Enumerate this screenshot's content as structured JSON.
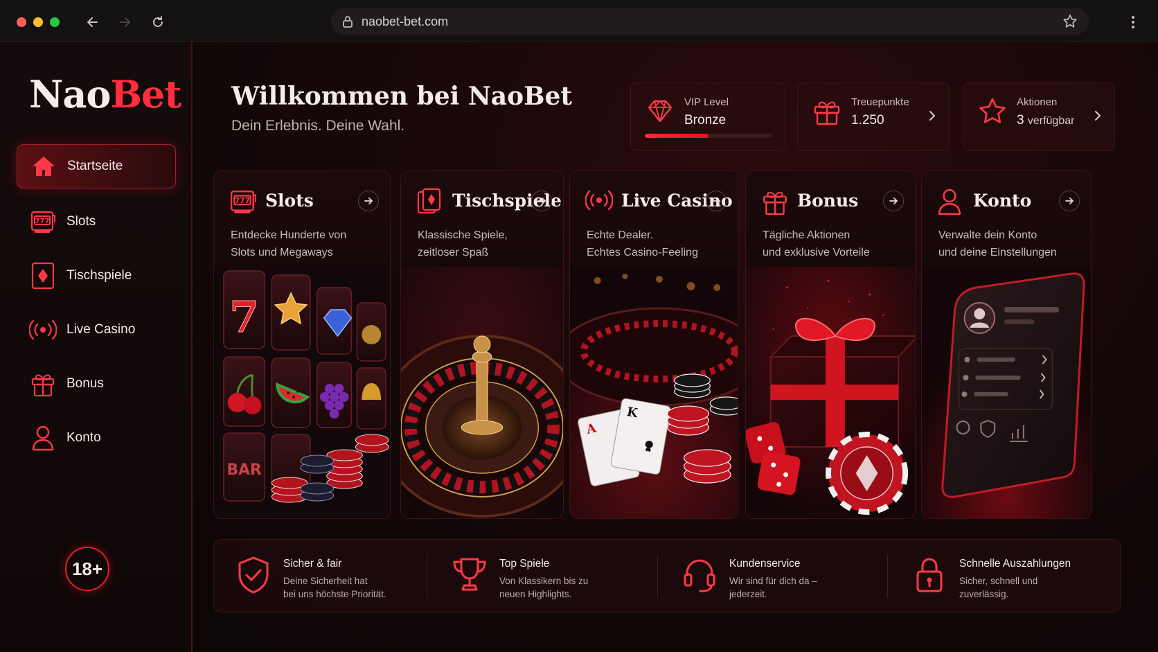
{
  "browser": {
    "url": "naobet-bet.com"
  },
  "brand": {
    "logo_part1": "Nao",
    "logo_part2": "Bet",
    "accent": "#ff2d3d"
  },
  "sidebar": {
    "items": [
      {
        "label": "Startseite",
        "icon": "home-icon",
        "active": true
      },
      {
        "label": "Slots",
        "icon": "slot-machine-icon",
        "active": false
      },
      {
        "label": "Tischspiele",
        "icon": "card-diamond-icon",
        "active": false
      },
      {
        "label": "Live Casino",
        "icon": "live-broadcast-icon",
        "active": false
      },
      {
        "label": "Bonus",
        "icon": "gift-icon",
        "active": false
      },
      {
        "label": "Konto",
        "icon": "user-icon",
        "active": false
      }
    ],
    "age_badge": "18+"
  },
  "header": {
    "title": "Willkommen bei NaoBet",
    "tagline": "Dein Erlebnis. Deine Wahl."
  },
  "stats": {
    "vip": {
      "label": "VIP Level",
      "value": "Bronze",
      "progress": 0.5
    },
    "points": {
      "label": "Treuepunkte",
      "value": "1.250"
    },
    "promos": {
      "label": "Aktionen",
      "value_num": "3",
      "value_text": "verfügbar"
    }
  },
  "cards": [
    {
      "title": "Slots",
      "desc1": "Entdecke Hunderte von",
      "desc2": "Slots und Megaways",
      "icon": "slot-machine-icon"
    },
    {
      "title": "Tischspiele",
      "desc1": "Klassische Spiele,",
      "desc2": "zeitloser Spaß",
      "icon": "card-diamond-icon"
    },
    {
      "title": "Live Casino",
      "desc1": "Echte Dealer.",
      "desc2": "Echtes Casino-Feeling",
      "icon": "live-broadcast-icon"
    },
    {
      "title": "Bonus",
      "desc1": "Tägliche Aktionen",
      "desc2": "und exklusive Vorteile",
      "icon": "gift-icon"
    },
    {
      "title": "Konto",
      "desc1": "Verwalte dein Konto",
      "desc2": "und deine Einstellungen",
      "icon": "user-icon"
    }
  ],
  "art_labels": {
    "slot_seven": "7",
    "slot_bar": "BAR",
    "card_ace": "A",
    "card_king": "K"
  },
  "features": [
    {
      "title": "Sicher & fair",
      "desc1": "Deine Sicherheit hat",
      "desc2": "bei uns höchste Priorität.",
      "icon": "shield-check-icon"
    },
    {
      "title": "Top Spiele",
      "desc1": "Von Klassikern bis zu",
      "desc2": "neuen Highlights.",
      "icon": "trophy-icon"
    },
    {
      "title": "Kundenservice",
      "desc1": "Wir sind für dich da –",
      "desc2": "jederzeit.",
      "icon": "headset-icon"
    },
    {
      "title": "Schnelle Auszahlungen",
      "desc1": "Sicher, schnell und",
      "desc2": "zuverlässig.",
      "icon": "lock-icon"
    }
  ]
}
